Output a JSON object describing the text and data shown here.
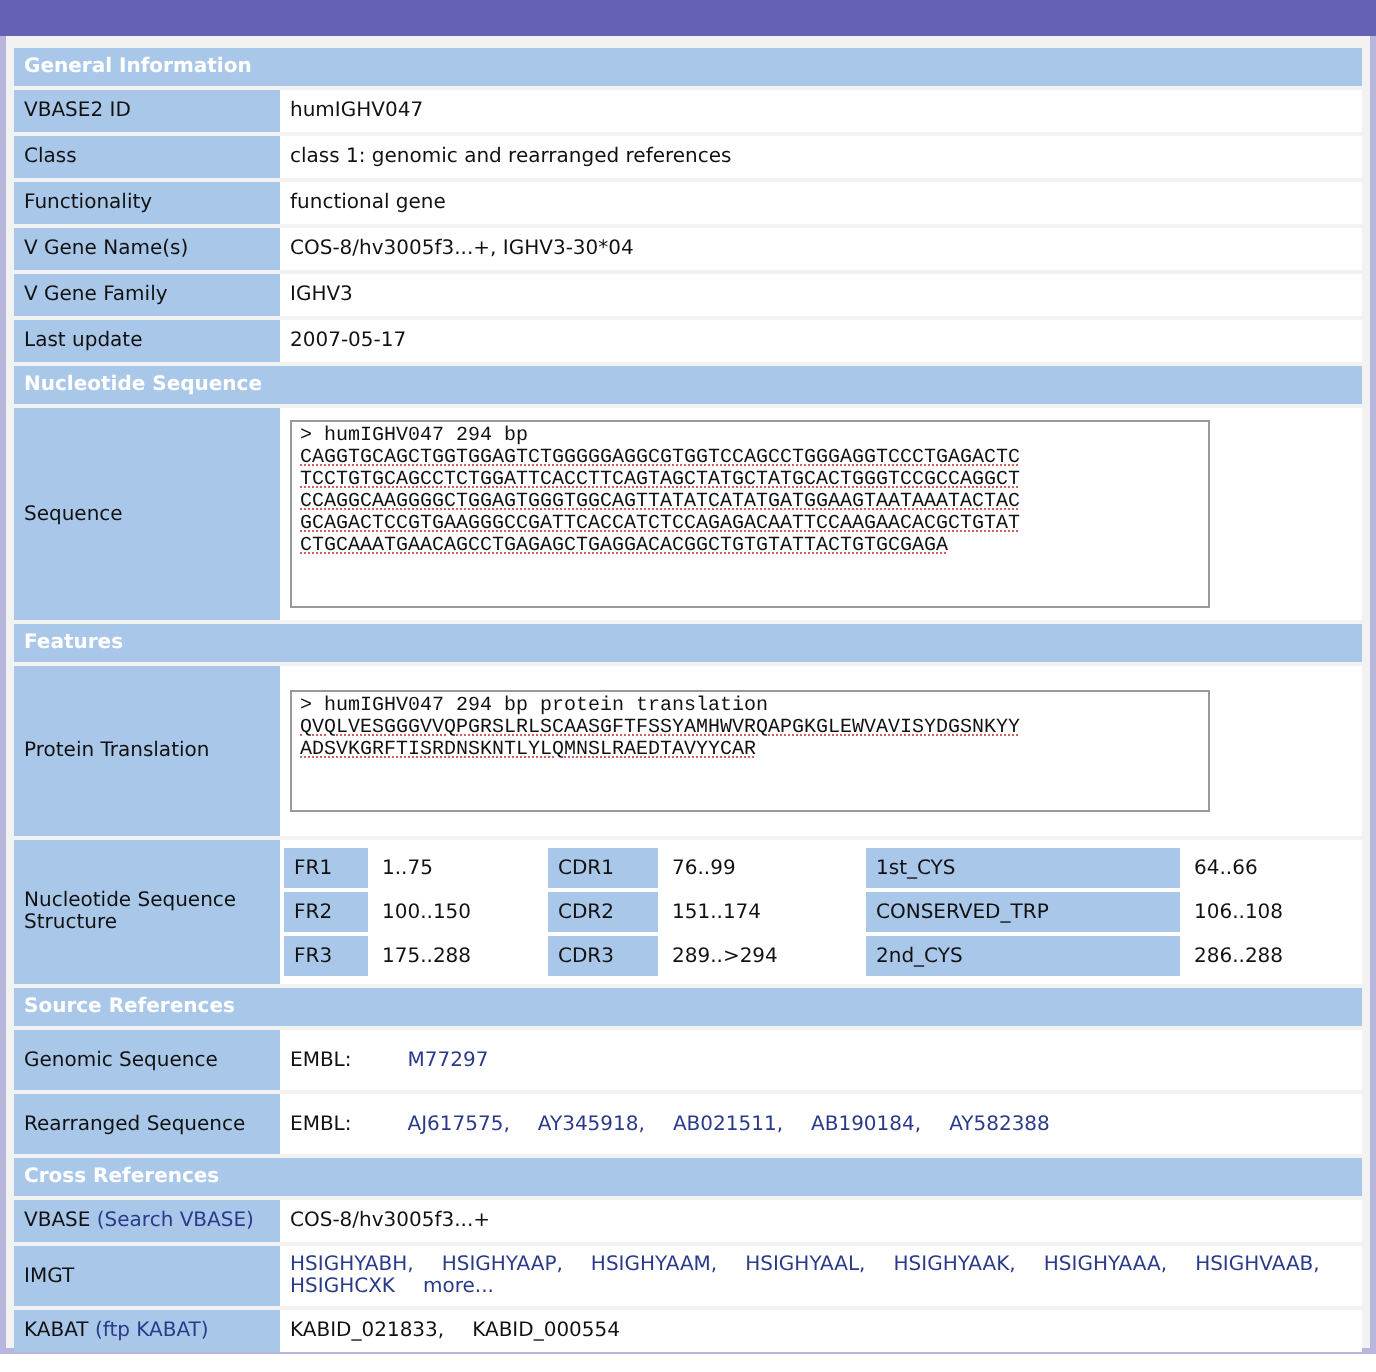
{
  "sections": [
    {
      "title": "General Information",
      "rows": [
        {
          "kind": "text",
          "label": "VBASE2 ID",
          "value": "humIGHV047"
        },
        {
          "kind": "text",
          "label": "Class",
          "value": "class 1: genomic and rearranged references"
        },
        {
          "kind": "text",
          "label": "Functionality",
          "value": "functional gene"
        },
        {
          "kind": "text",
          "label": "V Gene Name(s)",
          "value": "COS-8/hv3005f3...+, IGHV3-30*04"
        },
        {
          "kind": "text",
          "label": "V Gene Family",
          "value": "IGHV3"
        },
        {
          "kind": "text",
          "label": "Last update",
          "value": "2007-05-17"
        }
      ]
    },
    {
      "title": "Nucleotide Sequence",
      "rows": [
        {
          "kind": "textarea",
          "label": "Sequence",
          "lines": [
            "> humIGHV047 294 bp",
            "CAGGTGCAGCTGGTGGAGTCTGGGGGAGGCGTGGTCCAGCCTGGGAGGTCCCTGAGACTC",
            "TCCTGTGCAGCCTCTGGATTCACCTTCAGTAGCTATGCTATGCACTGGGTCCGCCAGGCT",
            "CCAGGCAAGGGGCTGGAGTGGGTGGCAGTTATATCATATGATGGAAGTAATAAATACTAC",
            "GCAGACTCCGTGAAGGGCCGATTCACCATCTCCAGAGACAATTCCAAGAACACGCTGTAT",
            "CTGCAAATGAACAGCCTGAGAGCTGAGGACACGGCTGTGTATTACTGTGCGAGA"
          ]
        }
      ]
    },
    {
      "title": "Features",
      "rows": [
        {
          "kind": "textarea",
          "label": "Protein Translation",
          "lines": [
            "> humIGHV047 294 bp protein translation",
            "QVQLVESGGGVVQPGRSLRLSCAASGFTFSSYAMHWVRQAPGKGLEWVAVISYDGSNKYY",
            "ADSVKGRFTISRDNSKNTLYLQMNSLRAEDTAVYYCAR"
          ]
        },
        {
          "kind": "structure",
          "label": "Nucleotide Sequence Structure",
          "cells": [
            [
              "FR1",
              "1..75",
              "CDR1",
              "76..99",
              "1st_CYS",
              "64..66"
            ],
            [
              "FR2",
              "100..150",
              "CDR2",
              "151..174",
              "CONSERVED_TRP",
              "106..108"
            ],
            [
              "FR3",
              "175..288",
              "CDR3",
              "289..>294",
              "2nd_CYS",
              "286..288"
            ]
          ]
        }
      ]
    },
    {
      "title": "Source References",
      "rows": [
        {
          "kind": "links",
          "label": "Genomic Sequence",
          "prefix": "EMBL:",
          "links": [
            "M77297"
          ]
        },
        {
          "kind": "links",
          "label": "Rearranged Sequence",
          "prefix": "EMBL:",
          "links": [
            "AJ617575,",
            "AY345918,",
            "AB021511,",
            "AB190184,",
            "AY582388"
          ]
        }
      ]
    },
    {
      "title": "Cross References",
      "rows": [
        {
          "kind": "text",
          "label": "VBASE",
          "label_link": "(Search VBASE)",
          "value": "COS-8/hv3005f3...+"
        },
        {
          "kind": "links",
          "label": "IMGT",
          "links": [
            "HSIGHYABH,",
            "HSIGHYAAP,",
            "HSIGHYAAM,",
            "HSIGHYAAL,",
            "HSIGHYAAK,",
            "HSIGHYAAA,",
            "HSIGHVAAB,",
            "HSIGHCXK",
            "more..."
          ]
        },
        {
          "kind": "plain-list",
          "label": "KABAT",
          "label_link": "(ftp KABAT)",
          "items": [
            "KABID_021833,",
            "KABID_000554"
          ]
        }
      ]
    }
  ]
}
